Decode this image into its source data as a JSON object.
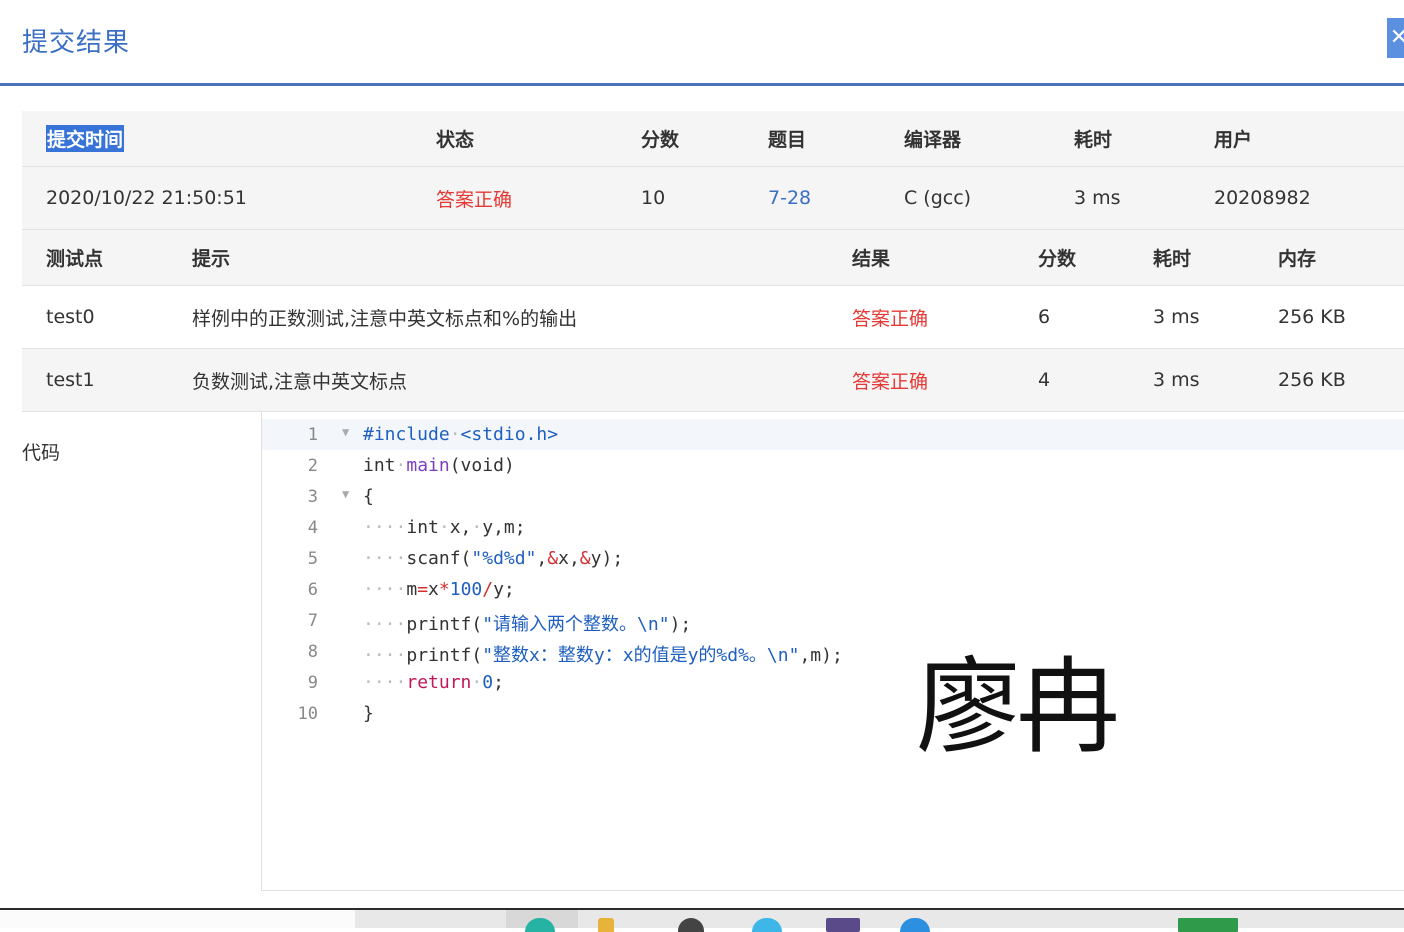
{
  "dialog": {
    "title": "提交结果",
    "close_label": "✕"
  },
  "submission": {
    "headers": [
      "提交时间",
      "状态",
      "分数",
      "题目",
      "编译器",
      "耗时",
      "用户"
    ],
    "row": {
      "time": "2020/10/22 21:50:51",
      "status": "答案正确",
      "score": "10",
      "problem": "7-28",
      "compiler": "C (gcc)",
      "duration": "3 ms",
      "user": "20208982"
    }
  },
  "tests": {
    "headers": [
      "测试点",
      "提示",
      "结果",
      "分数",
      "耗时",
      "内存"
    ],
    "rows": [
      {
        "id": "test0",
        "hint": "样例中的正数测试,注意中英文标点和%的输出",
        "result": "答案正确",
        "score": "6",
        "duration": "3 ms",
        "memory": "256 KB"
      },
      {
        "id": "test1",
        "hint": "负数测试,注意中英文标点",
        "result": "答案正确",
        "score": "4",
        "duration": "3 ms",
        "memory": "256 KB"
      }
    ]
  },
  "code": {
    "label": "代码",
    "line_numbers": [
      "1",
      "2",
      "3",
      "4",
      "5",
      "6",
      "7",
      "8",
      "9",
      "10"
    ]
  },
  "watermark": "廖冉",
  "colors": {
    "accent": "#3a6fc4",
    "success_red": "#e53935",
    "header_rule": "#4a72b8"
  }
}
